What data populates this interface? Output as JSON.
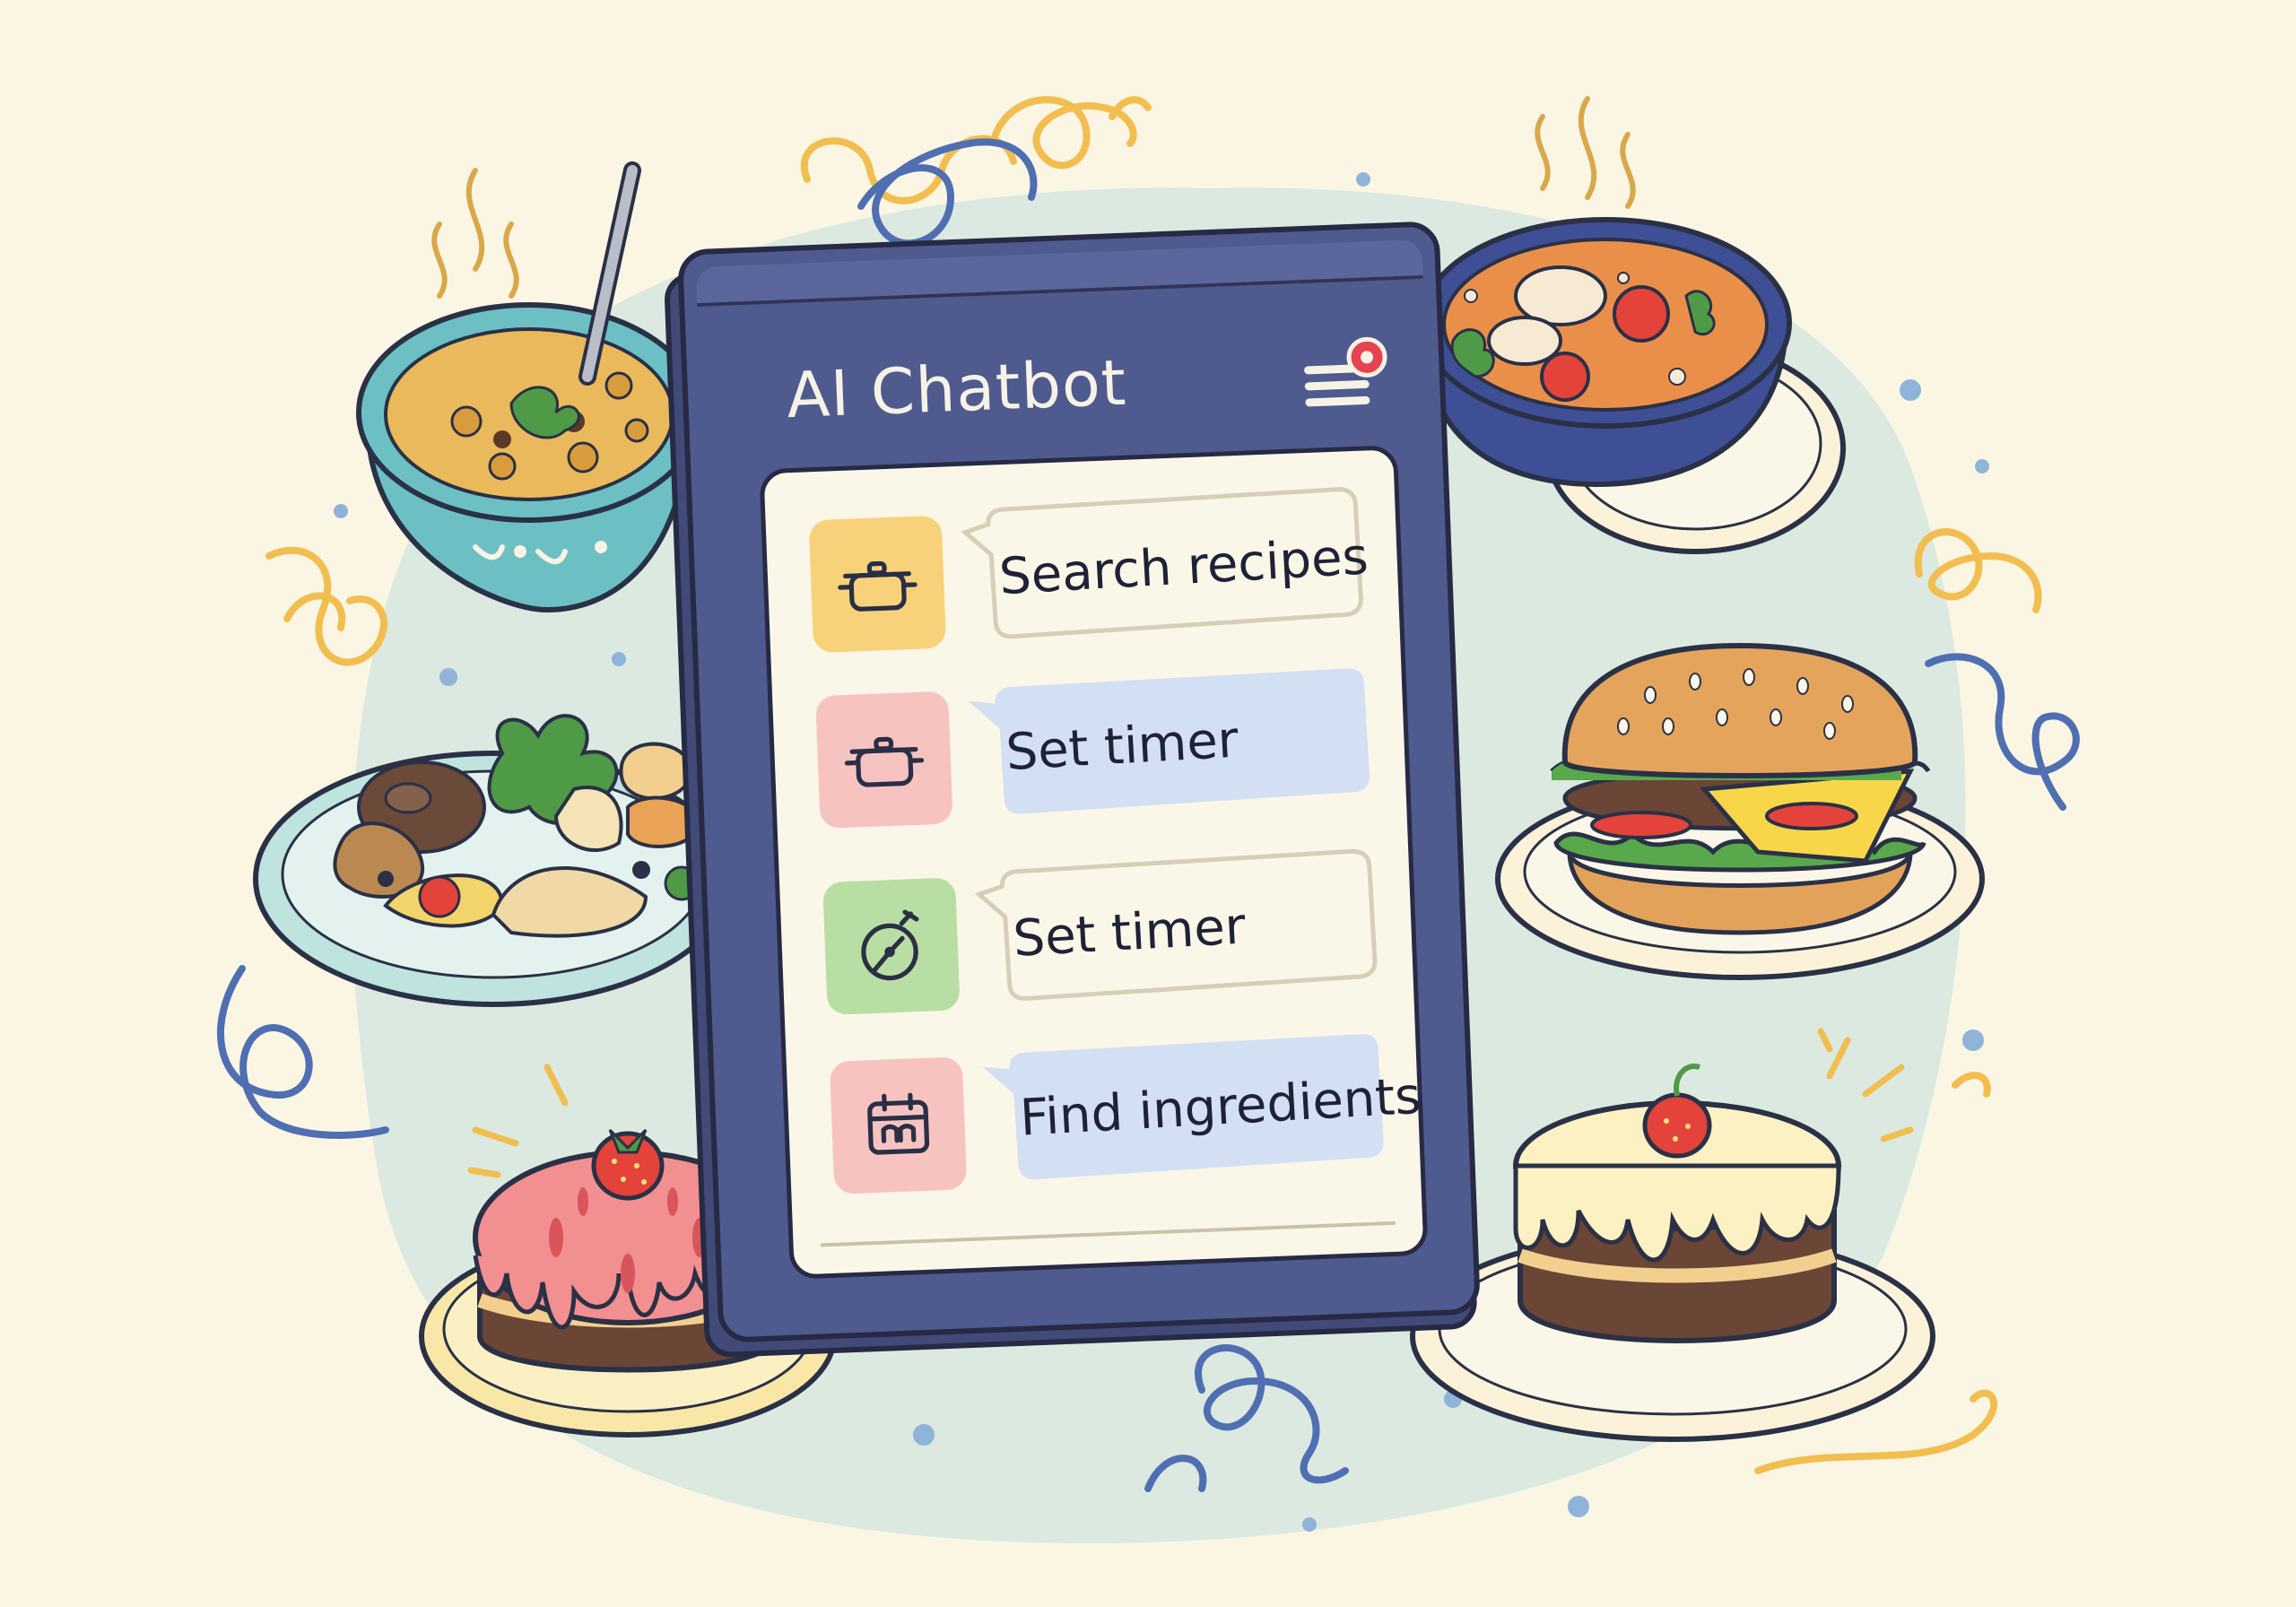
{
  "app": {
    "title": "AI Chatbot",
    "menu_icon": "hamburger-menu-icon",
    "notification_indicator": true
  },
  "actions": [
    {
      "label": "Search recipes",
      "icon": "cooking-pot-icon",
      "tile_color": "#f7d27a",
      "bubble_style": "outlined"
    },
    {
      "label": "Set timer",
      "icon": "cooking-pot-icon",
      "tile_color": "#f6c3c1",
      "bubble_style": "filled"
    },
    {
      "label": "Set timer",
      "icon": "timer-icon",
      "tile_color": "#b9dea3",
      "bubble_style": "outlined"
    },
    {
      "label": "Find ingredients",
      "icon": "calendar-icon",
      "tile_color": "#f6c3c1",
      "bubble_style": "filled"
    }
  ],
  "colors": {
    "background": "#fbf6e4",
    "blob": "#dbe9e0",
    "device": "#4f5a8e",
    "panel": "#fbf7e8",
    "bubble_filled": "#d3dff3",
    "notification_dot": "#e8414f"
  }
}
